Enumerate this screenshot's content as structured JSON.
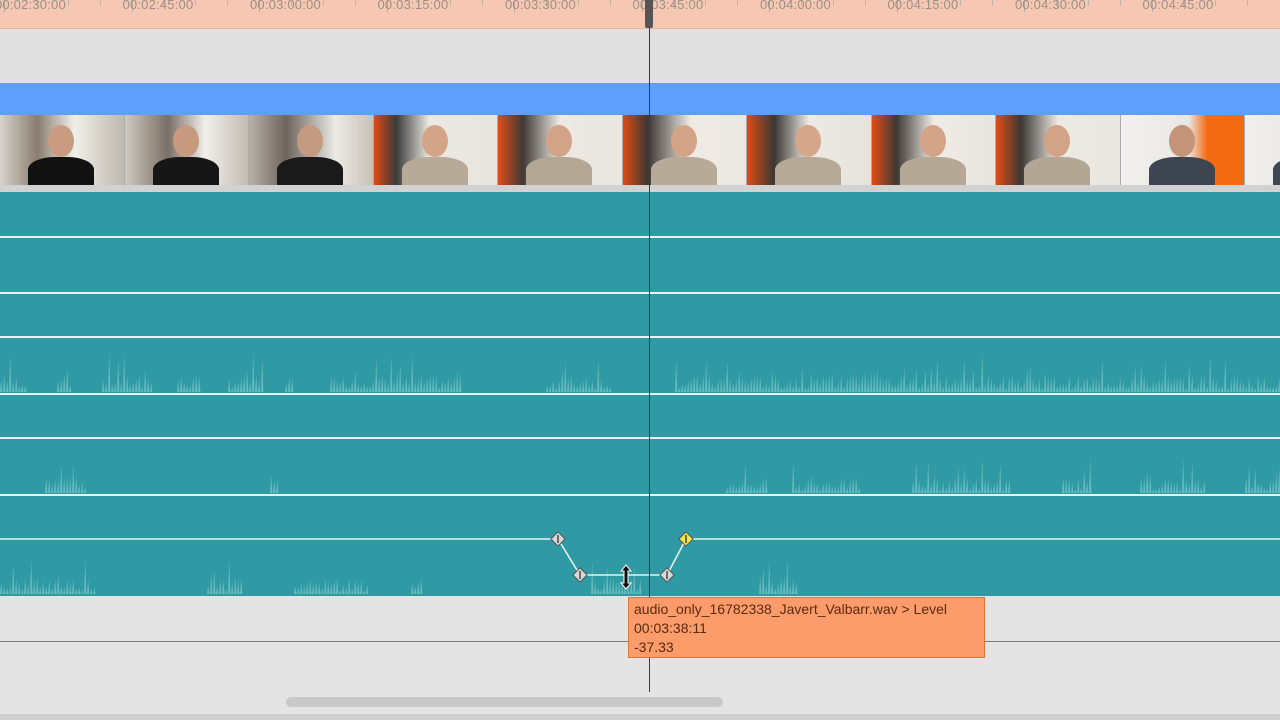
{
  "ruler": {
    "labels": [
      "00:02:30:00",
      "00:02:45:00",
      "00:03:00:00",
      "00:03:15:00",
      "00:03:30:00",
      "00:03:45:00",
      "00:04:00:00",
      "00:04:15:00",
      "00:04:30:00",
      "00:04:45:00"
    ]
  },
  "video_track": {
    "thumbnails": [
      "thumb-1",
      "thumb-2",
      "thumb-3",
      "thumb-4",
      "thumb-5",
      "thumb-6",
      "thumb-7",
      "thumb-8",
      "thumb-9",
      "thumb-10",
      "thumb-11"
    ]
  },
  "tooltip": {
    "clip_label": "audio_only_16782338_Javert_Valbarr.wav > Level",
    "timecode": "00:03:38:11",
    "value": "-37.33"
  },
  "colors": {
    "ruler_bg": "#f6c8b3",
    "video_bar": "#5d9ffb",
    "audio_track": "#2f9aa3",
    "waveform": "#6fc0c4",
    "tooltip_bg": "#fb9c6a",
    "keyframe_selected": "#f3e64a",
    "keyframe": "#d8d8d8"
  }
}
